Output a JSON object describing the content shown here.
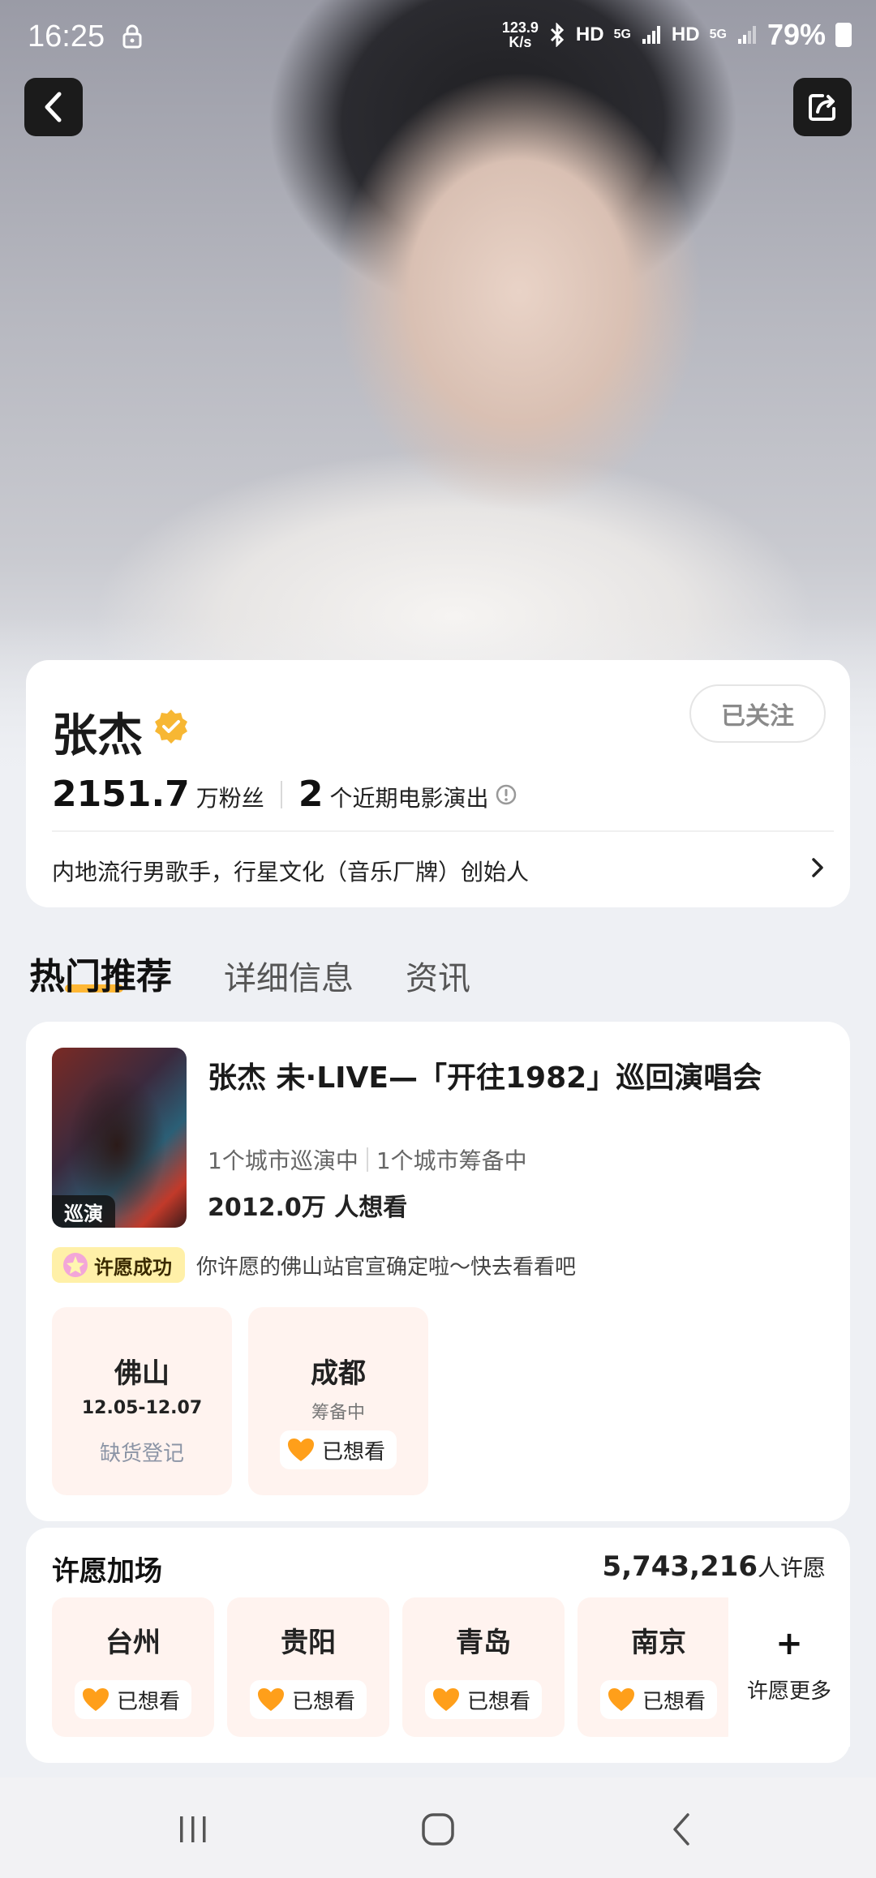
{
  "status_bar": {
    "time": "16:25",
    "speed_value": "123.9",
    "speed_unit": "K/s",
    "hd1": "HD",
    "net1": "5G",
    "hd2": "HD",
    "net2": "5G",
    "battery": "79%"
  },
  "profile": {
    "name": "张杰",
    "follow_label": "已关注",
    "fans_count": "2151.7",
    "fans_label": "万粉丝",
    "shows_count": "2",
    "shows_label": "个近期电影演出",
    "bio": "内地流行男歌手，行星文化（音乐厂牌）创始人"
  },
  "tabs": [
    {
      "label": "热门推荐"
    },
    {
      "label": "详细信息"
    },
    {
      "label": "资讯"
    }
  ],
  "tour": {
    "poster_tag": "巡演",
    "title": "张杰 未·LIVE—「开往1982」巡回演唱会",
    "cities_touring": "1个城市巡演中",
    "cities_preparing": "1个城市筹备中",
    "want_count": "2012.0万 人想看",
    "wish_badge": "许愿成功",
    "wish_message": "你许愿的佛山站官宣确定啦～快去看看吧",
    "city_tiles": [
      {
        "city": "佛山",
        "date": "12.05-12.07",
        "action": "缺货登记"
      },
      {
        "city": "成都",
        "status": "筹备中",
        "action": "已想看"
      }
    ]
  },
  "wish": {
    "title": "许愿加场",
    "count": "5,743,216",
    "count_label": "人许愿",
    "cities": [
      {
        "city": "台州",
        "action": "已想看"
      },
      {
        "city": "贵阳",
        "action": "已想看"
      },
      {
        "city": "青岛",
        "action": "已想看"
      },
      {
        "city": "南京",
        "action": "已想看"
      }
    ],
    "more_plus": "+",
    "more_label": "许愿更多"
  },
  "icons": {
    "back": "chevron-left-icon",
    "share": "share-icon",
    "verified": "verified-badge-icon",
    "info": "info-circle-icon",
    "heart": "heart-icon"
  },
  "colors": {
    "accent_orange": "#ffb020",
    "tile_bg": "#fff3ef",
    "badge_yellow": "#fff0a8"
  }
}
